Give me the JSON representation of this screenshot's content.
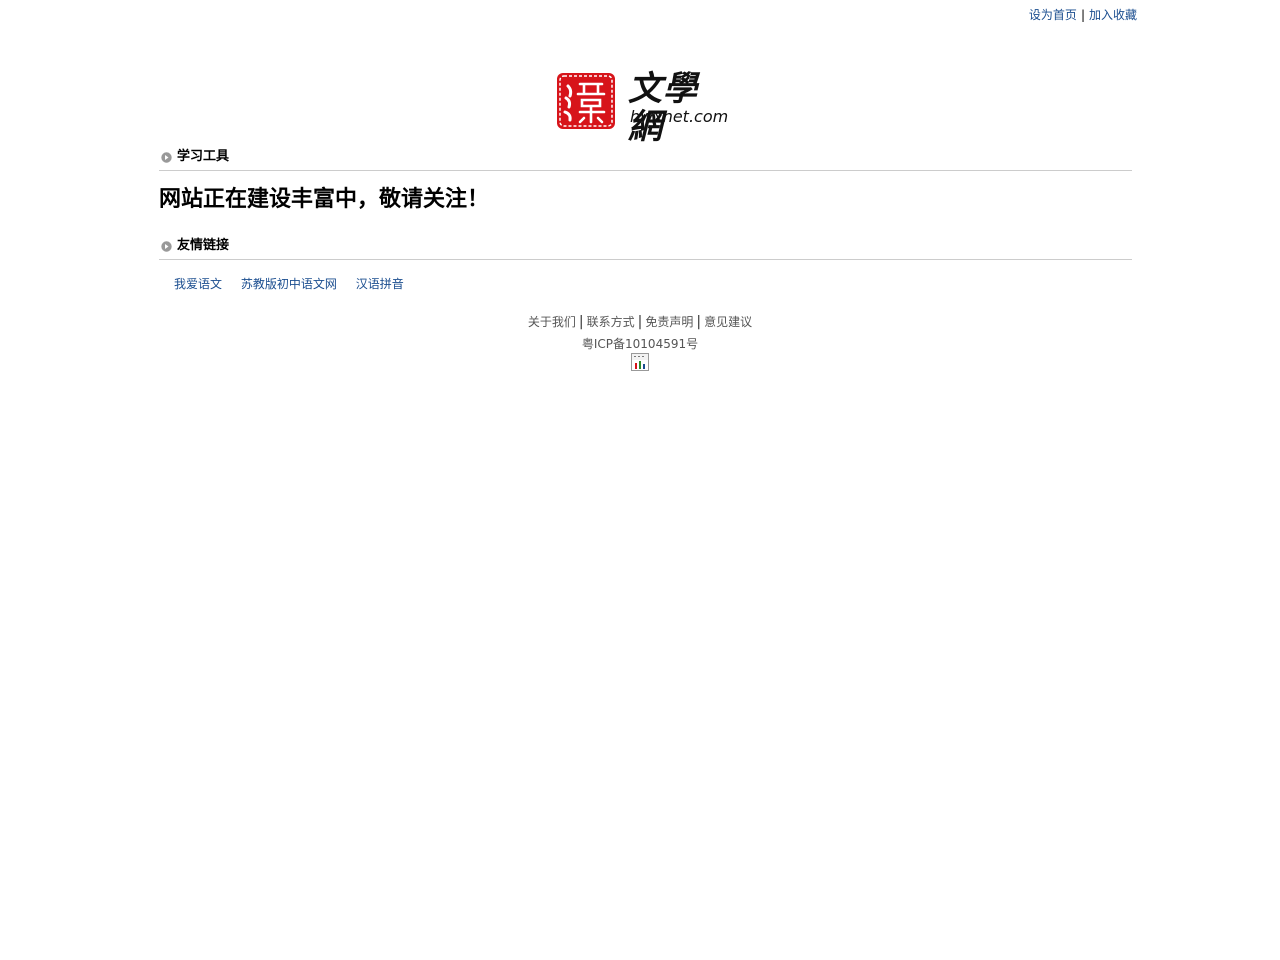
{
  "top_links": {
    "set_home": "设为首页",
    "separator": "|",
    "add_favorite": "加入收藏"
  },
  "logo": {
    "icon": "seal-logo-icon",
    "cjk_text": "文學網",
    "latin_text": "hwxnet.com",
    "seal_color": "#d7141a"
  },
  "sections": {
    "tools_title": "学习工具",
    "links_title": "友情链接"
  },
  "notice": "网站正在建设丰富中，敬请关注！",
  "friend_links": [
    "我爱语文",
    "苏教版初中语文网",
    "汉语拼音"
  ],
  "footer": {
    "nav": [
      "关于我们",
      "联系方式",
      "免责声明",
      "意见建议"
    ],
    "separator": "|",
    "icp": "粤ICP备10104591号",
    "counter_icon": "cnzz-counter-icon"
  },
  "colors": {
    "link": "#1a4d8f",
    "divider": "#cccccc",
    "bullet": "#999999"
  }
}
